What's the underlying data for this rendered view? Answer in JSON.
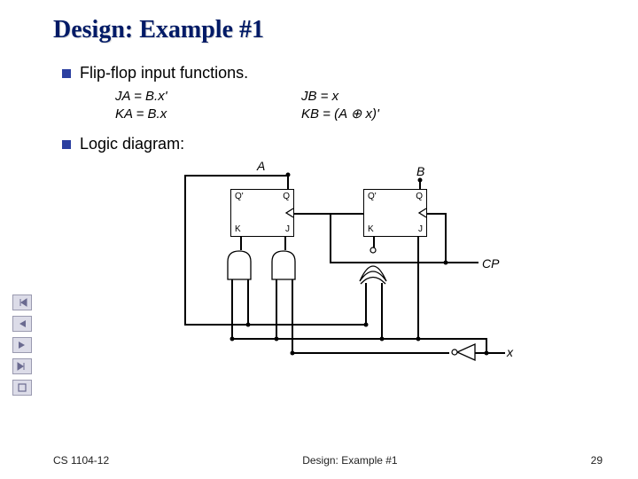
{
  "title": "Design: Example #1",
  "bullets": {
    "ff_inputs": "Flip-flop input functions.",
    "logic": "Logic diagram:"
  },
  "equations": {
    "ja": "JA = B.x'",
    "ka": "KA = B.x",
    "jb": "JB = x",
    "kb": "KB = (A ⊕ x)'"
  },
  "diagram": {
    "a": "A",
    "b": "B",
    "cp": "CP",
    "x": "x",
    "qp": "Q'",
    "q": "Q",
    "k": "K",
    "j": "J"
  },
  "footer": {
    "left": "CS 1104-12",
    "center": "Design: Example #1",
    "right": "29"
  }
}
